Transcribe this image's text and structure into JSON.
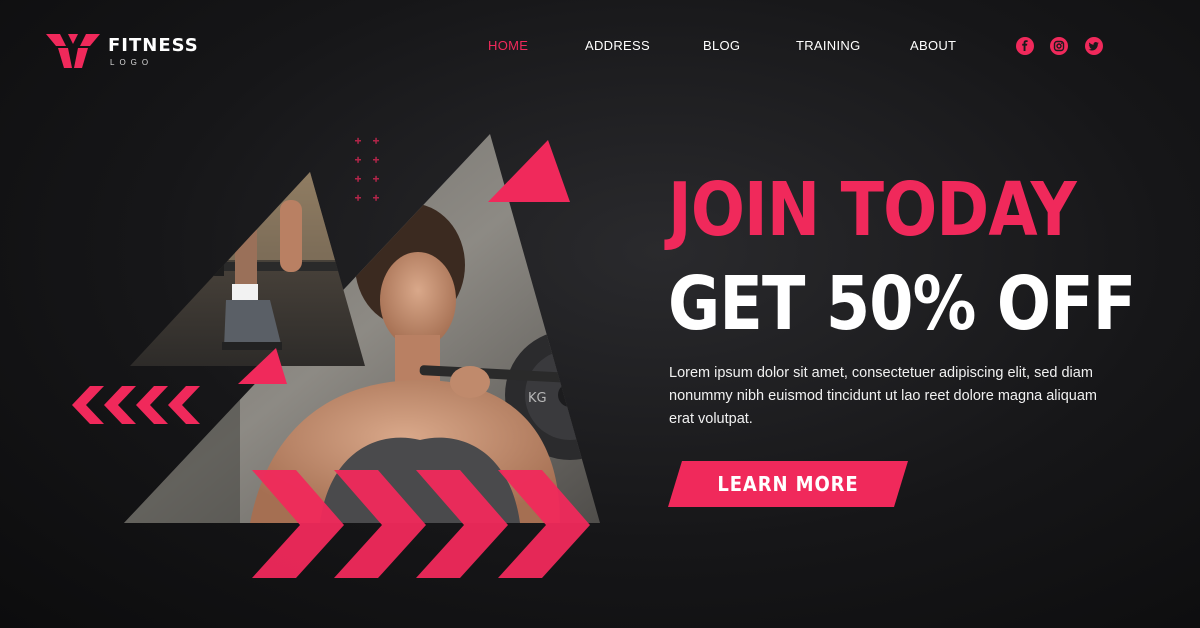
{
  "brand": {
    "name": "FITNESS",
    "tagline": "LOGO"
  },
  "nav": {
    "items": [
      {
        "label": "HOME",
        "active": true
      },
      {
        "label": "ADDRESS",
        "active": false
      },
      {
        "label": "BLOG",
        "active": false
      },
      {
        "label": "TRAINING",
        "active": false
      },
      {
        "label": "ABOUT",
        "active": false
      }
    ]
  },
  "social": [
    "facebook-icon",
    "instagram-icon",
    "twitter-icon"
  ],
  "hero": {
    "headline_line1": "JOIN TODAY",
    "headline_line2": "GET 50% OFF",
    "body": "Lorem ipsum dolor sit amet, consectetuer adipiscing elit, sed diam nonummy nibh euismod tincidunt ut lao reet dolore magna aliquam erat volutpat.",
    "cta_label": "LEARN MORE",
    "plate_text": "KG"
  },
  "colors": {
    "accent": "#f0295b",
    "background": "#161618",
    "text": "#ffffff"
  }
}
